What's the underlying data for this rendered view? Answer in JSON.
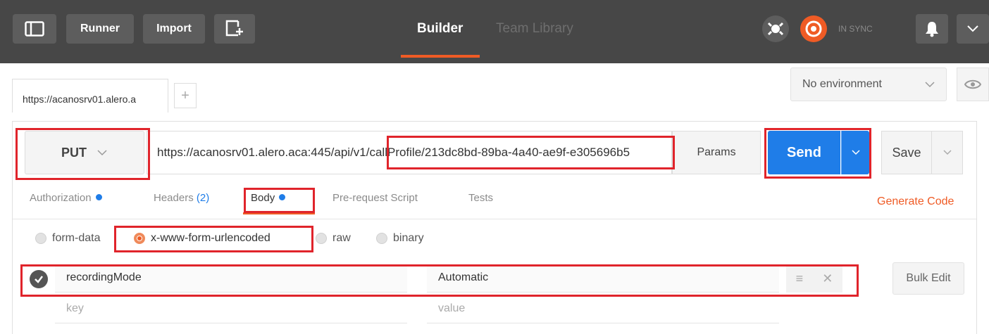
{
  "topbar": {
    "runner_label": "Runner",
    "import_label": "Import",
    "builder_label": "Builder",
    "team_library_label": "Team Library",
    "sync_label": "IN SYNC",
    "accent_color": "#ef5b25"
  },
  "tabs": {
    "request_tab_label": "https://acanosrv01.alero.a",
    "add_tab_label": "+",
    "environment_label": "No environment"
  },
  "request": {
    "method": "PUT",
    "url": "https://acanosrv01.alero.aca:445/api/v1/callProfile/213dc8bd-89ba-4a40-ae9f-e305696b5",
    "params_label": "Params",
    "send_label": "Send",
    "save_label": "Save",
    "send_color": "#1f7de8"
  },
  "subtabs": {
    "authorization_label": "Authorization",
    "headers_label": "Headers",
    "headers_count": "(2)",
    "body_label": "Body",
    "prerequest_label": "Pre-request Script",
    "tests_label": "Tests",
    "generate_code_label": "Generate Code"
  },
  "body_types": {
    "form_data_label": "form-data",
    "urlencoded_label": "x-www-form-urlencoded",
    "raw_label": "raw",
    "binary_label": "binary",
    "selected": "x-www-form-urlencoded"
  },
  "kv": {
    "rows": [
      {
        "key": "recordingMode",
        "value": "Automatic"
      }
    ],
    "key_placeholder": "key",
    "value_placeholder": "value",
    "bulk_edit_label": "Bulk Edit"
  }
}
